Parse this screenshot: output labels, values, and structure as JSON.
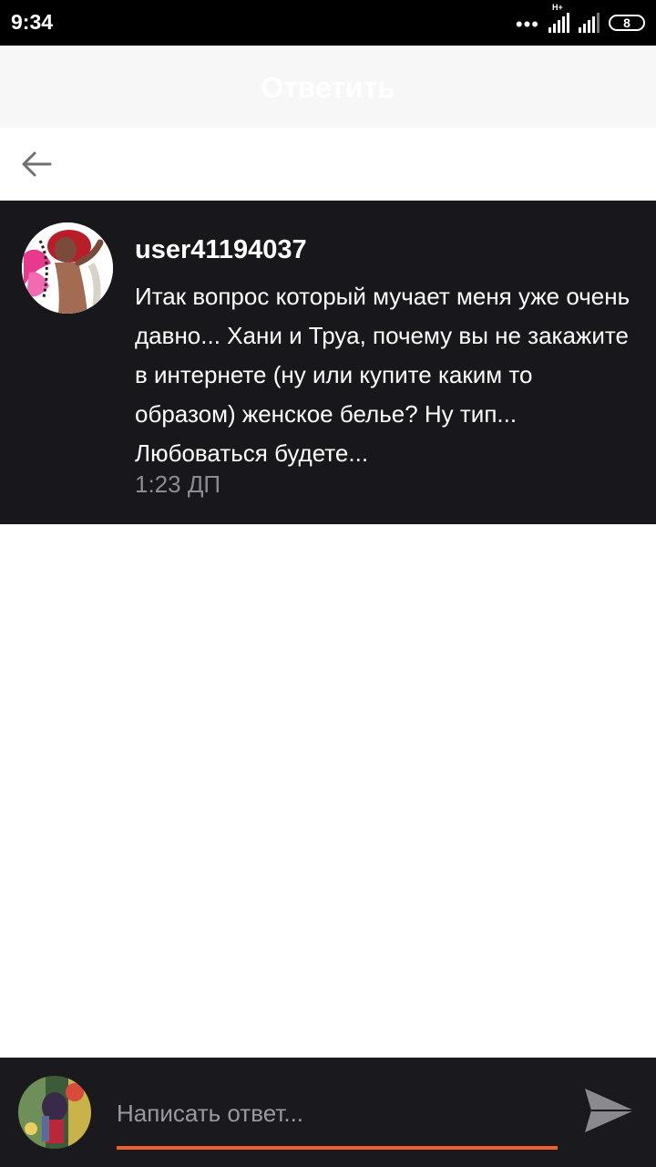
{
  "status_bar": {
    "time": "9:34",
    "network_type": "H+",
    "battery_level": "8"
  },
  "header": {
    "title": "Ответить"
  },
  "nav": {
    "back_icon": "arrow-left-icon"
  },
  "message": {
    "username": "user41194037",
    "text": "Итак вопрос который мучает меня уже очень давно... Хани и Труа, почему вы не закажите в интернете (ну или купите каким то образом) женское белье? Ну тип... Любоваться будете...",
    "time": "1:23 ДП"
  },
  "reply": {
    "placeholder": "Написать ответ...",
    "send_icon": "send-icon"
  },
  "colors": {
    "accent": "#f0602a",
    "message_bg": "#18171b",
    "reply_bg": "#1a191d"
  }
}
